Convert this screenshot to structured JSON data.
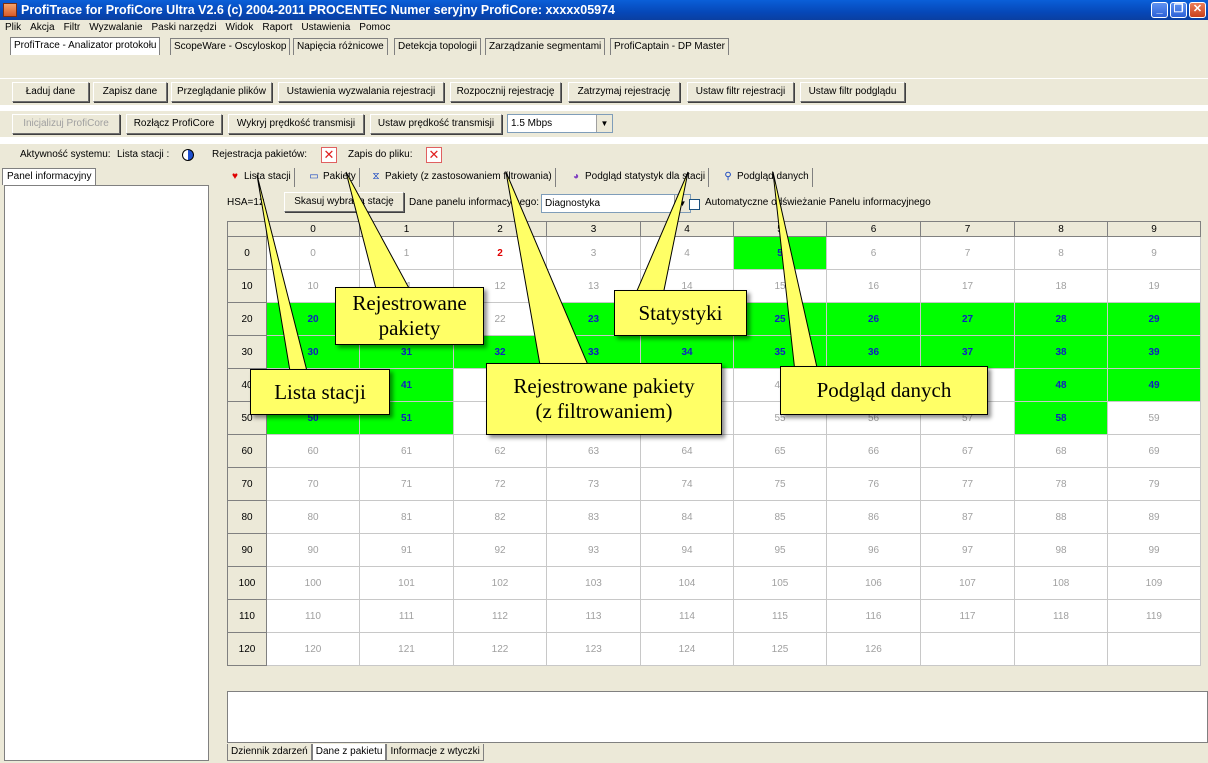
{
  "window": {
    "title": "ProfiTrace for ProfiCore Ultra V2.6 (c) 2004-2011 PROCENTEC  Numer seryjny ProfiCore: xxxxx05974",
    "controls": [
      "minimize-icon",
      "restore-icon",
      "close-icon"
    ]
  },
  "menu": [
    "Plik",
    "Akcja",
    "Filtr",
    "Wyzwalanie",
    "Paski narzędzi",
    "Widok",
    "Raport",
    "Ustawienia",
    "Pomoc"
  ],
  "main_tabs": [
    "ProfiTrace - Analizator protokołu",
    "ScopeWare - Oscyloskop",
    "Napięcia różnicowe",
    "Detekcja topologii",
    "Zarządzanie segmentami",
    "ProfiCaptain - DP Master"
  ],
  "toolbar1": [
    "Ładuj dane",
    "Zapisz dane",
    "Przeglądanie plików",
    "Ustawienia wyzwalania rejestracji",
    "Rozpocznij rejestrację",
    "Zatrzymaj rejestrację",
    "Ustaw filtr rejestracji",
    "Ustaw filtr podglądu"
  ],
  "toolbar2": {
    "init": "Inicjalizuj ProfiCore",
    "disconnect": "Rozłącz ProfiCore",
    "detect": "Wykryj prędkość transmisji",
    "set": "Ustaw prędkość transmisji",
    "baud": "1.5 Mbps"
  },
  "status": {
    "activity": "Aktywność systemu:",
    "stations": "Lista stacji :",
    "recording": "Rejestracja pakietów:",
    "file": "Zapis do pliku:"
  },
  "left_panel": {
    "tab": "Panel informacyjny"
  },
  "sub_tabs": [
    {
      "icon": "heart-icon",
      "label": "Lista stacji"
    },
    {
      "icon": "packet-icon",
      "label": "Pakiety"
    },
    {
      "icon": "filter-icon",
      "label": "Pakiety (z zastosowaniem filtrowania)"
    },
    {
      "icon": "pie-chart-icon",
      "label": "Podgląd statystyk dla stacji"
    },
    {
      "icon": "magnifier-icon",
      "label": "Podgląd danych"
    }
  ],
  "station_toolbar": {
    "hsa": "HSA=12",
    "delete": "Skasuj wybraną stację",
    "panel_label": "Dane panelu informacyjnego:",
    "panel_value": "Diagnostyka",
    "auto_refresh": "Automatyczne odświeżanie Panelu informacyjnego"
  },
  "grid": {
    "columns": [
      "0",
      "1",
      "2",
      "3",
      "4",
      "5",
      "6",
      "7",
      "8",
      "9"
    ],
    "rows": [
      "0",
      "10",
      "20",
      "30",
      "40",
      "50",
      "60",
      "70",
      "80",
      "90",
      "100",
      "110",
      "120"
    ],
    "active_stations": [
      5,
      20,
      23,
      25,
      26,
      27,
      28,
      29,
      30,
      31,
      32,
      33,
      34,
      35,
      36,
      37,
      38,
      39,
      40,
      41,
      48,
      49,
      50,
      51,
      58
    ],
    "error_stations": [
      2
    ],
    "max_station": 126
  },
  "bottom_tabs": [
    "Dziennik zdarzeń",
    "Dane z pakietu",
    "Informacje z wtyczki"
  ],
  "callouts": {
    "stations": "Lista stacji",
    "packets_l1": "Rejestrowane",
    "packets_l2": "pakiety",
    "filtered_l1": "Rejestrowane pakiety",
    "filtered_l2": "(z filtrowaniem)",
    "stats": "Statystyki",
    "data": "Podgląd danych"
  },
  "colors": {
    "active_station": "#00ff00",
    "callout": "#ffff66",
    "title_bar": "#0648b8"
  }
}
